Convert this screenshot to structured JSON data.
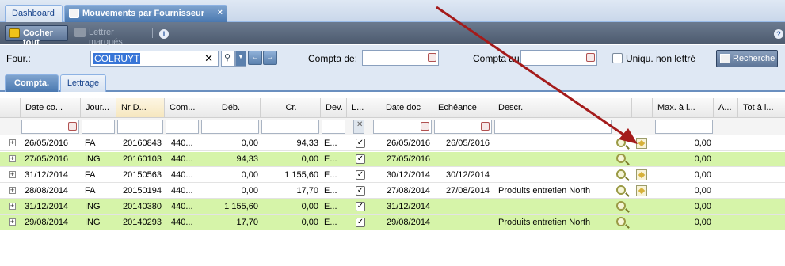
{
  "tabs": {
    "dashboard": "Dashboard",
    "active": "Mouvements par Fournisseur",
    "close": "×"
  },
  "toolbar": {
    "check_all": "Cocher tout",
    "letter_marked": "Lettrer marqués",
    "info": "i",
    "help": "?"
  },
  "filters": {
    "supplier_label": "Four.:",
    "supplier_value": "COLRUYT",
    "account_from_label": "Compta de:",
    "account_to_label": "Compta au",
    "unlettered_label": "Uniqu. non lettré",
    "search_button": "Recherche"
  },
  "subtabs": {
    "accounting": "Compta.",
    "lettering": "Lettrage"
  },
  "columns": [
    "Date co...",
    "Jour...",
    "Nr D...",
    "Com...",
    "Déb.",
    "Cr.",
    "Dev.",
    "L...",
    "Date doc",
    "Echéance",
    "Descr.",
    "",
    "",
    "Max. à l...",
    "A...",
    "Tot à l..."
  ],
  "rows": [
    {
      "date": "26/05/2016",
      "journal": "FA",
      "nr": "20160843",
      "com": "440...",
      "deb": "0,00",
      "cr": "94,33",
      "dev": "E...",
      "docdate": "26/05/2016",
      "due": "26/05/2016",
      "descr": "",
      "max": "0,00",
      "green": false,
      "lettr": true
    },
    {
      "date": "27/05/2016",
      "journal": "ING",
      "nr": "20160103",
      "com": "440...",
      "deb": "94,33",
      "cr": "0,00",
      "dev": "E...",
      "docdate": "27/05/2016",
      "due": "",
      "descr": "",
      "max": "0,00",
      "green": true,
      "lettr": false
    },
    {
      "date": "31/12/2014",
      "journal": "FA",
      "nr": "20150563",
      "com": "440...",
      "deb": "0,00",
      "cr": "1 155,60",
      "dev": "E...",
      "docdate": "30/12/2014",
      "due": "30/12/2014",
      "descr": "",
      "max": "0,00",
      "green": false,
      "lettr": true
    },
    {
      "date": "28/08/2014",
      "journal": "FA",
      "nr": "20150194",
      "com": "440...",
      "deb": "0,00",
      "cr": "17,70",
      "dev": "E...",
      "docdate": "27/08/2014",
      "due": "27/08/2014",
      "descr": "Produits entretien North",
      "max": "0,00",
      "green": false,
      "lettr": true
    },
    {
      "date": "31/12/2014",
      "journal": "ING",
      "nr": "20140380",
      "com": "440...",
      "deb": "1 155,60",
      "cr": "0,00",
      "dev": "E...",
      "docdate": "31/12/2014",
      "due": "",
      "descr": "",
      "max": "0,00",
      "green": true,
      "lettr": false
    },
    {
      "date": "29/08/2014",
      "journal": "ING",
      "nr": "20140293",
      "com": "440...",
      "deb": "17,70",
      "cr": "0,00",
      "dev": "E...",
      "docdate": "29/08/2014",
      "due": "",
      "descr": "Produits entretien North",
      "max": "0,00",
      "green": true,
      "lettr": false
    }
  ],
  "colors": {
    "green_row": "#d6f4a9",
    "arrow": "#a41b1b",
    "toolbar": "#5a687c"
  }
}
